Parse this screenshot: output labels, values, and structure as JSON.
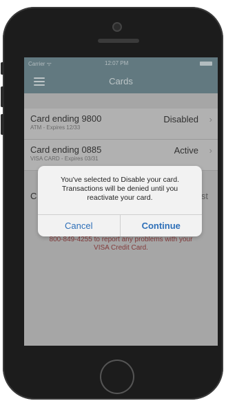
{
  "status": {
    "carrier": "Carrier ᯤ",
    "time": "12:07 PM"
  },
  "nav": {
    "title": "Cards"
  },
  "cards": [
    {
      "title": "Card ending 9800",
      "sub": "ATM - Expires 12/33",
      "status": "Disabled"
    },
    {
      "title": "Card ending 0885",
      "sub": "VISA CARD - Expires 03/31",
      "status": "Active"
    }
  ],
  "obscured_row": {
    "left": "C",
    "right": "st"
  },
  "report": {
    "line1": "800-849-4255 to report any problems with your",
    "line2": "VISA Credit Card."
  },
  "alert": {
    "line1": "You've selected to Disable your card.",
    "line2": "Transactions will be denied until you",
    "line3": "reactivate your card.",
    "cancel": "Cancel",
    "continue": "Continue"
  }
}
